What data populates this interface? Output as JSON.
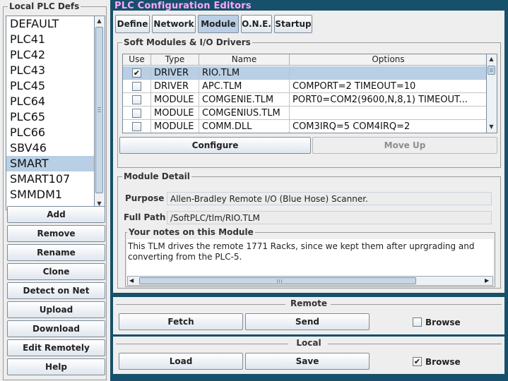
{
  "left": {
    "title": "Local PLC Defs",
    "plc_items": [
      "DEFAULT",
      "PLC41",
      "PLC42",
      "PLC43",
      "PLC45",
      "PLC64",
      "PLC65",
      "PLC66",
      "SBV46",
      "SMART",
      "SMART107",
      "SMMDM1"
    ],
    "selected_item": "SMART",
    "buttons": [
      "Add",
      "Remove",
      "Rename",
      "Clone",
      "Detect on Net",
      "Upload",
      "Download",
      "Edit Remotely",
      "Help"
    ]
  },
  "editors": {
    "title": "PLC Configuration Editors",
    "tabs": [
      "Define",
      "Network",
      "Module",
      "O.N.E.",
      "Startup"
    ],
    "active_tab": "Module"
  },
  "soft_modules": {
    "title": "Soft Modules & I/O Drivers",
    "columns": [
      "Use",
      "Type",
      "Name",
      "Options"
    ],
    "rows": [
      {
        "use": true,
        "type": "DRIVER",
        "name": "RIO.TLM",
        "options": "",
        "selected": true
      },
      {
        "use": false,
        "type": "DRIVER",
        "name": "APC.TLM",
        "options": "COMPORT=2  TIMEOUT=10"
      },
      {
        "use": false,
        "type": "MODULE",
        "name": "COMGENIE.TLM",
        "options": "PORT0=COM2(9600,N,8,1) TIMEOUT..."
      },
      {
        "use": false,
        "type": "MODULE",
        "name": "COMGENIUS.TLM",
        "options": ""
      },
      {
        "use": false,
        "type": "MODULE",
        "name": "COMM.DLL",
        "options": "COM3IRQ=5  COM4IRQ=2"
      }
    ],
    "configure_label": "Configure",
    "move_up_label": "Move Up"
  },
  "module_detail": {
    "title": "Module Detail",
    "purpose_label": "Purpose",
    "purpose_value": "Allen-Bradley Remote I/O (Blue Hose) Scanner.",
    "fullpath_label": "Full Path",
    "fullpath_value": "/SoftPLC/tlm/RIO.TLM",
    "notes_title": "Your notes on this Module",
    "notes_line1": "This TLM drives the remote 1771 Racks, since we kept them after uprgrading and",
    "notes_line2": "converting from the PLC-5."
  },
  "remote": {
    "title": "Remote",
    "fetch_label": "Fetch",
    "send_label": "Send",
    "browse_label": "Browse",
    "browse_checked": false
  },
  "local": {
    "title": "Local",
    "load_label": "Load",
    "save_label": "Save",
    "browse_label": "Browse",
    "browse_checked": true
  }
}
